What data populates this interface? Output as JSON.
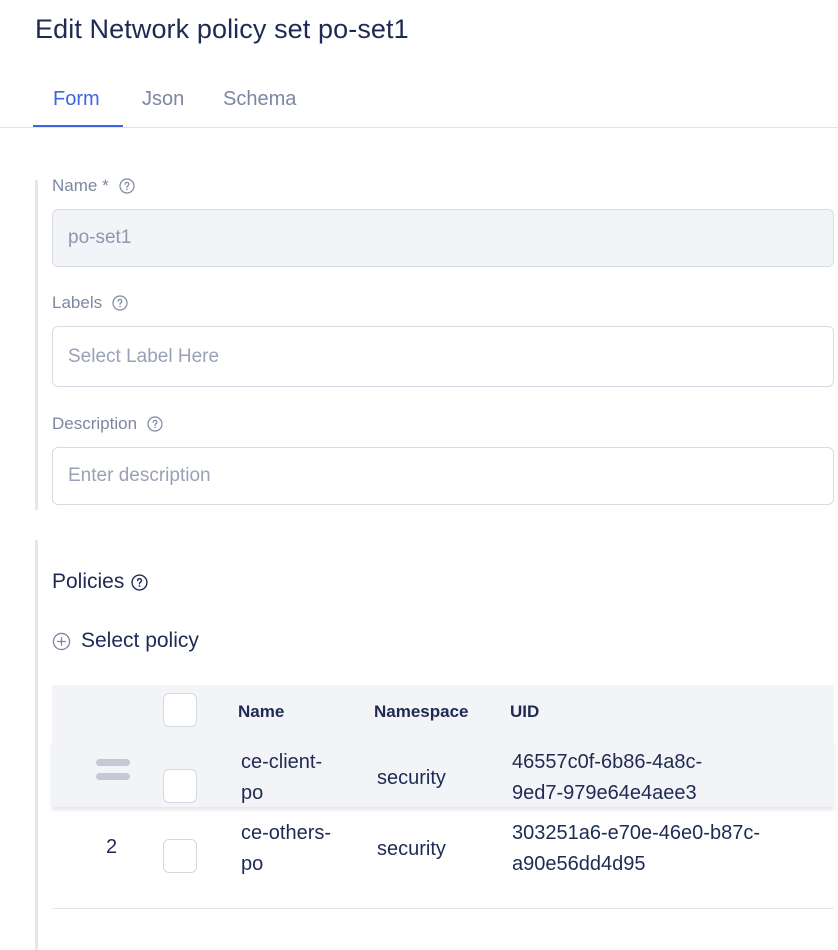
{
  "page": {
    "title": "Edit Network policy set po-set1"
  },
  "tabs": [
    {
      "label": "Form",
      "active": true
    },
    {
      "label": "Json",
      "active": false
    },
    {
      "label": "Schema",
      "active": false
    }
  ],
  "form": {
    "name": {
      "label": "Name *",
      "value": "po-set1"
    },
    "labels": {
      "label": "Labels",
      "placeholder": "Select Label Here"
    },
    "description": {
      "label": "Description",
      "placeholder": "Enter description"
    }
  },
  "policies": {
    "title": "Policies",
    "select_policy_label": "Select policy",
    "columns": {
      "name": "Name",
      "namespace": "Namespace",
      "uid": "UID"
    },
    "rows": [
      {
        "index": "",
        "name_line1": "ce-client-",
        "name_line2": "po",
        "namespace": "security",
        "uid_line1": "46557c0f-6b86-4a8c-",
        "uid_line2": "9ed7-979e64e4aee3",
        "dragging": true
      },
      {
        "index": "2",
        "name_line1": "ce-others-",
        "name_line2": "po",
        "namespace": "security",
        "uid_line1": "303251a6-e70e-46e0-b87c-",
        "uid_line2": "a90e56dd4d95",
        "dragging": false
      }
    ]
  },
  "colors": {
    "accent": "#3f66e0",
    "text": "#1f2a52",
    "muted": "#7e87a2"
  },
  "icons": {
    "help": "question-circle-icon",
    "add": "plus-circle-icon",
    "drag": "drag-handle-icon"
  }
}
